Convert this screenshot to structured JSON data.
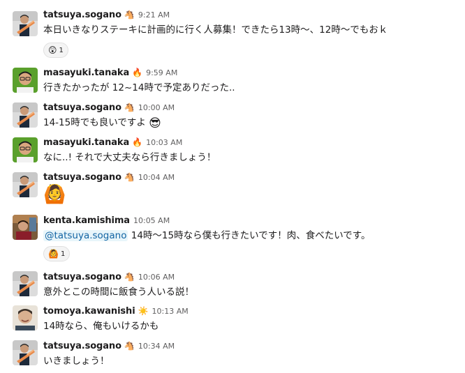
{
  "messages": [
    {
      "author": "tatsuya.sogano",
      "status": "🐴",
      "time": "9:21 AM",
      "text": "本日いきなりステーキに計画的に行く人募集！できたら13時〜、12時〜でもおｋ",
      "reaction": {
        "emoji": "😲",
        "count": "1"
      }
    },
    {
      "author": "masayuki.tanaka",
      "status": "🔥",
      "time": "9:59 AM",
      "text": "行きたかったが 12~14時で予定ありだった.."
    },
    {
      "author": "tatsuya.sogano",
      "status": "🐴",
      "time": "10:00 AM",
      "text": "14-15時でも良いですよ",
      "emoji": "😎"
    },
    {
      "author": "masayuki.tanaka",
      "status": "🔥",
      "time": "10:03 AM",
      "text": "なに..! それで大丈夫なら行きましょう！"
    },
    {
      "author": "tatsuya.sogano",
      "status": "🐴",
      "time": "10:04 AM",
      "big_emoji": "🙆"
    },
    {
      "author": "kenta.kamishima",
      "time": "10:05 AM",
      "mention": "@tatsuya.sogano",
      "text": " 14時〜15時なら僕も行きたいです！肉、食べたいです。",
      "reaction": {
        "emoji": "🙆",
        "count": "1"
      }
    },
    {
      "author": "tatsuya.sogano",
      "status": "🐴",
      "time": "10:06 AM",
      "text": "意外とこの時間に飯食う人いる説！"
    },
    {
      "author": "tomoya.kawanishi",
      "status": "☀️",
      "time": "10:13 AM",
      "text": "14時なら、俺もいけるかも"
    },
    {
      "author": "tatsuya.sogano",
      "status": "🐴",
      "time": "10:34 AM",
      "text": "いきましょう！"
    }
  ]
}
